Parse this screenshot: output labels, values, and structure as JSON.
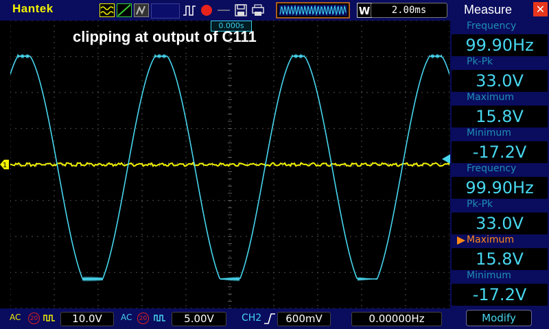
{
  "brand": "Hantek",
  "timebase": "2.00ms",
  "trigger_time": "0.000s",
  "waveform_title": "clipping at output of C111",
  "colors": {
    "ch1": "#f2f200",
    "ch2": "#47d6ee",
    "bar": "#0a0c5e",
    "close": "#e8361c"
  },
  "icons": [
    "wave-type-icon",
    "ramp-icon",
    "persist-icon",
    "trigger-edge-icon",
    "record-icon",
    "save-icon",
    "print-icon",
    "window-w-icon"
  ],
  "measure": {
    "title": "Measure",
    "items": [
      {
        "label": "Frequency",
        "value": "99.90Hz"
      },
      {
        "label": "Pk-Pk",
        "value": "33.0V"
      },
      {
        "label": "Maximum",
        "value": "15.8V"
      },
      {
        "label": "Minimum",
        "value": "-17.2V"
      },
      {
        "label": "Frequency",
        "value": "99.90Hz"
      },
      {
        "label": "Pk-Pk",
        "value": "33.0V"
      },
      {
        "label": "Maximum",
        "value": "15.8V"
      },
      {
        "label": "Minimum",
        "value": "-17.2V"
      }
    ],
    "modify_label": "Modify"
  },
  "bottom": {
    "ch1_coupling": "AC",
    "ch1_bw": "20",
    "ch1_scale": "10.0V",
    "ch2_coupling": "AC",
    "ch2_bw": "20",
    "ch2_scale": "5.00V",
    "trig_source": "CH2",
    "trig_level": "600mV",
    "freq_counter": "0.00000Hz"
  }
}
